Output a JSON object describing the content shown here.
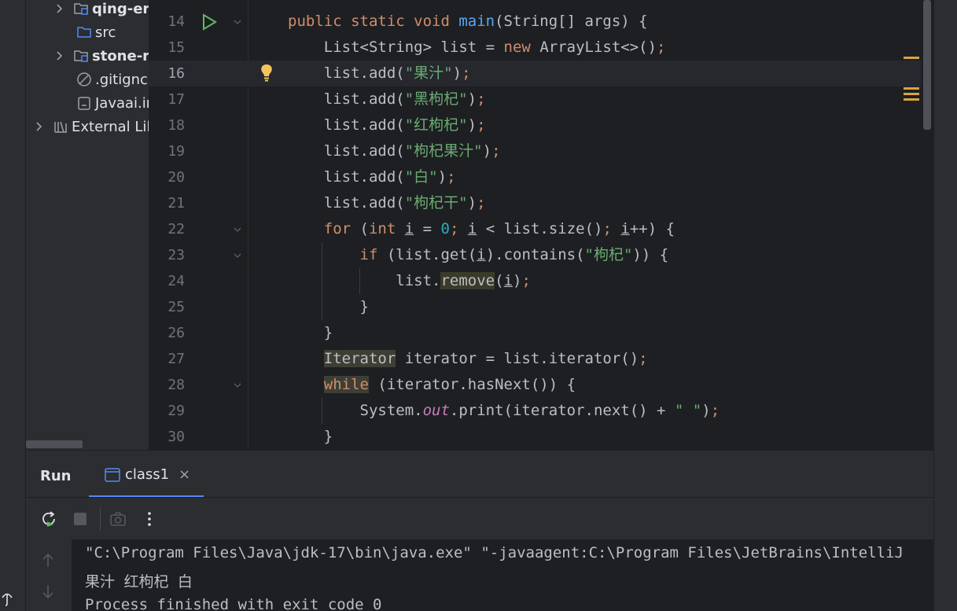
{
  "project_tree": {
    "items": [
      {
        "label": "qing-er",
        "type": "module"
      },
      {
        "label": "src",
        "type": "folder"
      },
      {
        "label": "stone-r",
        "type": "module"
      },
      {
        "label": ".gitignc",
        "type": "ignored-file"
      },
      {
        "label": "Javaai.ir",
        "type": "file"
      },
      {
        "label": "External Lil",
        "type": "libraries"
      }
    ]
  },
  "editor": {
    "current_line": 16,
    "lines": [
      {
        "n": "14",
        "segments": [
          {
            "t": "public static void ",
            "c": "kw"
          },
          {
            "t": "main",
            "c": "fn"
          },
          {
            "t": "(String[] args) {",
            "c": "pl"
          }
        ]
      },
      {
        "n": "15",
        "segments": [
          {
            "t": "    List<String> list = ",
            "c": "pl"
          },
          {
            "t": "new ",
            "c": "kw"
          },
          {
            "t": "ArrayList<>()",
            "c": "pl"
          },
          {
            "t": ";",
            "c": "kw"
          }
        ]
      },
      {
        "n": "16",
        "segments": [
          {
            "t": "    list.add(",
            "c": "pl"
          },
          {
            "t": "\"果汁\"",
            "c": "str"
          },
          {
            "t": ")",
            "c": "pl"
          },
          {
            "t": ";",
            "c": "kw"
          }
        ]
      },
      {
        "n": "17",
        "segments": [
          {
            "t": "    list.add(",
            "c": "pl"
          },
          {
            "t": "\"黑枸杞\"",
            "c": "str"
          },
          {
            "t": ")",
            "c": "pl"
          },
          {
            "t": ";",
            "c": "kw"
          }
        ]
      },
      {
        "n": "18",
        "segments": [
          {
            "t": "    list.add(",
            "c": "pl"
          },
          {
            "t": "\"红枸杞\"",
            "c": "str"
          },
          {
            "t": ")",
            "c": "pl"
          },
          {
            "t": ";",
            "c": "kw"
          }
        ]
      },
      {
        "n": "19",
        "segments": [
          {
            "t": "    list.add(",
            "c": "pl"
          },
          {
            "t": "\"枸杞果汁\"",
            "c": "str"
          },
          {
            "t": ")",
            "c": "pl"
          },
          {
            "t": ";",
            "c": "kw"
          }
        ]
      },
      {
        "n": "20",
        "segments": [
          {
            "t": "    list.add(",
            "c": "pl"
          },
          {
            "t": "\"白\"",
            "c": "str"
          },
          {
            "t": ")",
            "c": "pl"
          },
          {
            "t": ";",
            "c": "kw"
          }
        ]
      },
      {
        "n": "21",
        "segments": [
          {
            "t": "    list.add(",
            "c": "pl"
          },
          {
            "t": "\"枸杞干\"",
            "c": "str"
          },
          {
            "t": ")",
            "c": "pl"
          },
          {
            "t": ";",
            "c": "kw"
          }
        ]
      },
      {
        "n": "22",
        "segments": [
          {
            "t": "    ",
            "c": "pl"
          },
          {
            "t": "for ",
            "c": "kw"
          },
          {
            "t": "(",
            "c": "pl"
          },
          {
            "t": "int ",
            "c": "kw"
          },
          {
            "t": "i",
            "c": "ul"
          },
          {
            "t": " = ",
            "c": "pl"
          },
          {
            "t": "0",
            "c": "num"
          },
          {
            "t": "; ",
            "c": "kw"
          },
          {
            "t": "i",
            "c": "ul"
          },
          {
            "t": " < list.size()",
            "c": "pl"
          },
          {
            "t": "; ",
            "c": "kw"
          },
          {
            "t": "i",
            "c": "ul"
          },
          {
            "t": "++) {",
            "c": "pl"
          }
        ]
      },
      {
        "n": "23",
        "segments": [
          {
            "t": "        ",
            "c": "pl"
          },
          {
            "t": "if ",
            "c": "kw"
          },
          {
            "t": "(list.get(",
            "c": "pl"
          },
          {
            "t": "i",
            "c": "ul"
          },
          {
            "t": ").contains(",
            "c": "pl"
          },
          {
            "t": "\"枸杞\"",
            "c": "str"
          },
          {
            "t": ")) {",
            "c": "pl"
          }
        ]
      },
      {
        "n": "24",
        "segments": [
          {
            "t": "            list.",
            "c": "pl"
          },
          {
            "t": "remove",
            "c": "hl"
          },
          {
            "t": "(",
            "c": "pl"
          },
          {
            "t": "i",
            "c": "ul"
          },
          {
            "t": ")",
            "c": "pl"
          },
          {
            "t": ";",
            "c": "kw"
          }
        ]
      },
      {
        "n": "25",
        "segments": [
          {
            "t": "        }",
            "c": "pl"
          }
        ]
      },
      {
        "n": "26",
        "segments": [
          {
            "t": "    }",
            "c": "pl"
          }
        ]
      },
      {
        "n": "27",
        "segments": [
          {
            "t": "    ",
            "c": "pl"
          },
          {
            "t": "Iterator",
            "c": "hl2"
          },
          {
            "t": " iterator = list.iterator()",
            "c": "pl"
          },
          {
            "t": ";",
            "c": "kw"
          }
        ]
      },
      {
        "n": "28",
        "segments": [
          {
            "t": "    ",
            "c": "pl"
          },
          {
            "t": "while",
            "c": "kwhl"
          },
          {
            "t": " (iterator.hasNext()) {",
            "c": "pl"
          }
        ]
      },
      {
        "n": "29",
        "segments": [
          {
            "t": "        System.",
            "c": "pl"
          },
          {
            "t": "out",
            "c": "ital"
          },
          {
            "t": ".print(iterator.next() + ",
            "c": "pl"
          },
          {
            "t": "\" \"",
            "c": "str"
          },
          {
            "t": ")",
            "c": "pl"
          },
          {
            "t": ";",
            "c": "kw"
          }
        ]
      },
      {
        "n": "30",
        "segments": [
          {
            "t": "    }",
            "c": "pl"
          }
        ]
      }
    ]
  },
  "run_panel": {
    "title": "Run",
    "tab_label": "class1",
    "tab_close": "×"
  },
  "console": {
    "lines": [
      "\"C:\\Program Files\\Java\\jdk-17\\bin\\java.exe\" \"-javaagent:C:\\Program Files\\JetBrains\\IntelliJ",
      "果汁 红枸杞 白",
      "Process finished with exit code 0"
    ]
  },
  "colors": {
    "keyword": "#cf8e6d",
    "function": "#56a8f5",
    "string": "#6aab73",
    "number": "#2aacb8",
    "accent": "#548af7"
  }
}
